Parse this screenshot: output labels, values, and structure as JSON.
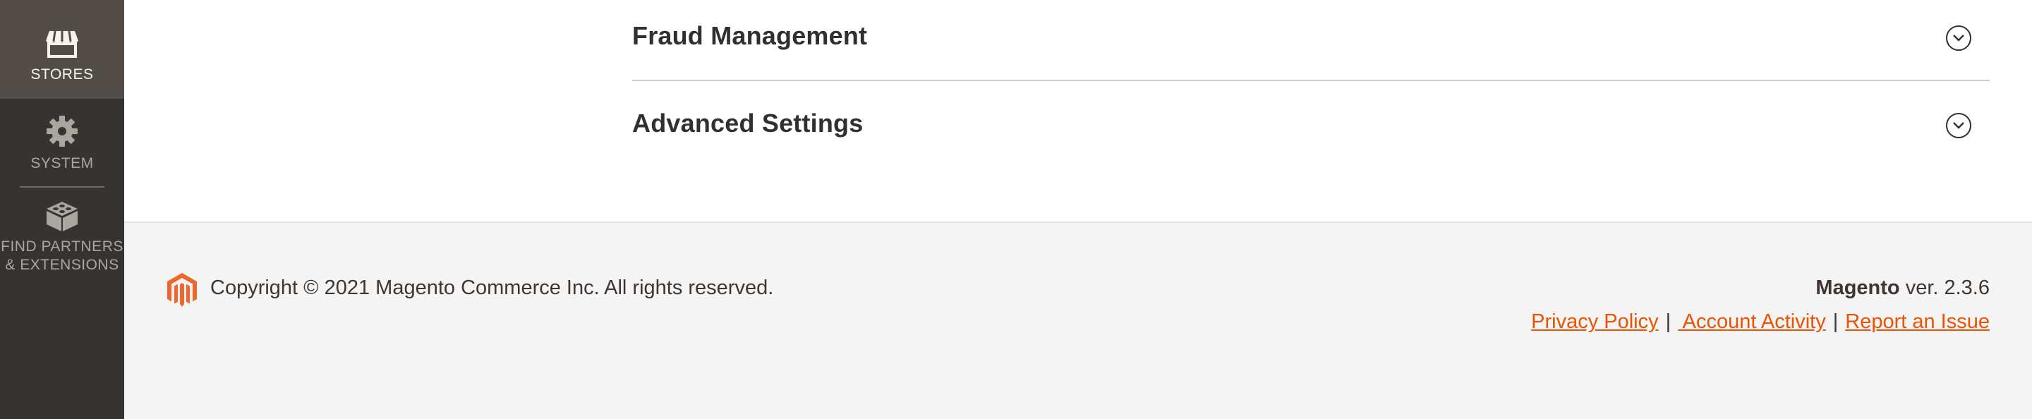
{
  "sidebar": {
    "items": [
      {
        "label": "STORES",
        "icon": "storefront-icon",
        "active": true
      },
      {
        "label": "SYSTEM",
        "icon": "gear-icon",
        "active": false
      },
      {
        "label": "FIND PARTNERS\n& EXTENSIONS",
        "icon": "extension-blocks-icon",
        "active": false
      }
    ]
  },
  "sections": [
    {
      "title": "Fraud Management",
      "icon": "chevron-down-circle-icon"
    },
    {
      "title": "Advanced Settings",
      "icon": "chevron-down-circle-icon"
    }
  ],
  "footer": {
    "logo": "magento-logo",
    "copyright": "Copyright © 2021 Magento Commerce Inc. All rights reserved.",
    "version_brand": "Magento",
    "version_text": " ver. 2.3.6",
    "links": {
      "privacy": "Privacy Policy",
      "account_activity": " Account Activity",
      "report_issue": "Report an Issue",
      "separator": "|"
    }
  },
  "colors": {
    "sidebar_bg": "#373330",
    "sidebar_active_bg": "#524d49",
    "link": "#eb5202",
    "footer_bg": "#f4f4f4",
    "logo": "#ef672f"
  }
}
